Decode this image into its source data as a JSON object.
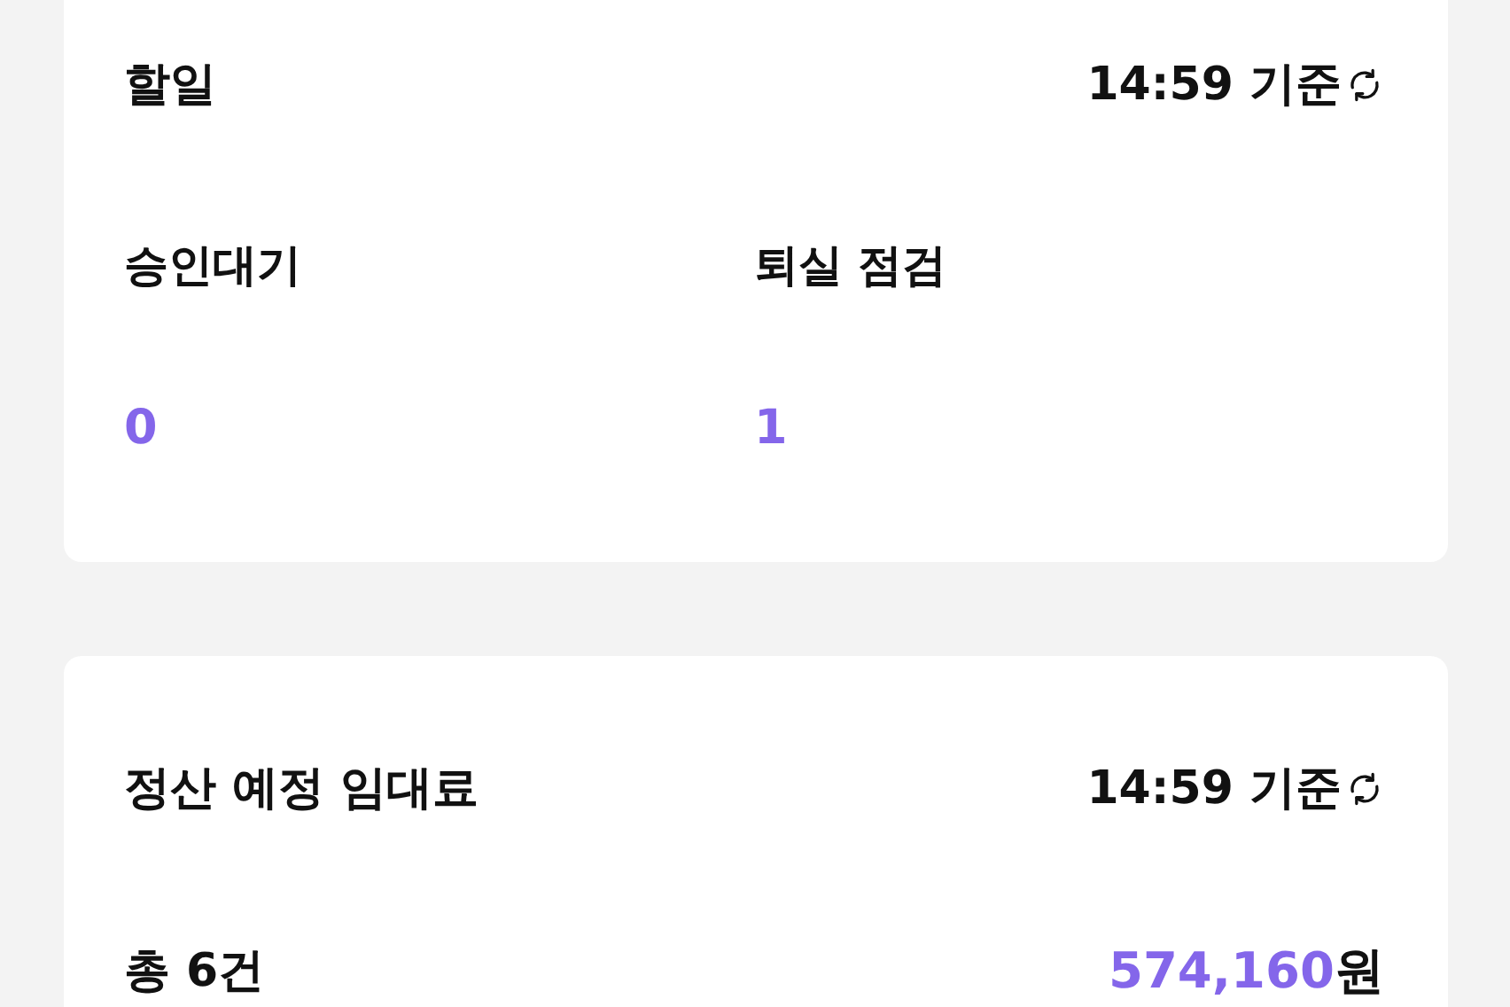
{
  "todo_card": {
    "title": "할일",
    "updated": "14:59 기준",
    "stats": [
      {
        "label": "승인대기",
        "value": "0"
      },
      {
        "label": "퇴실 점검",
        "value": "1"
      }
    ]
  },
  "rent_card": {
    "title": "정산 예정 임대료",
    "updated": "14:59 기준",
    "total": "총 6건",
    "amount": "574,160",
    "unit": "원"
  }
}
